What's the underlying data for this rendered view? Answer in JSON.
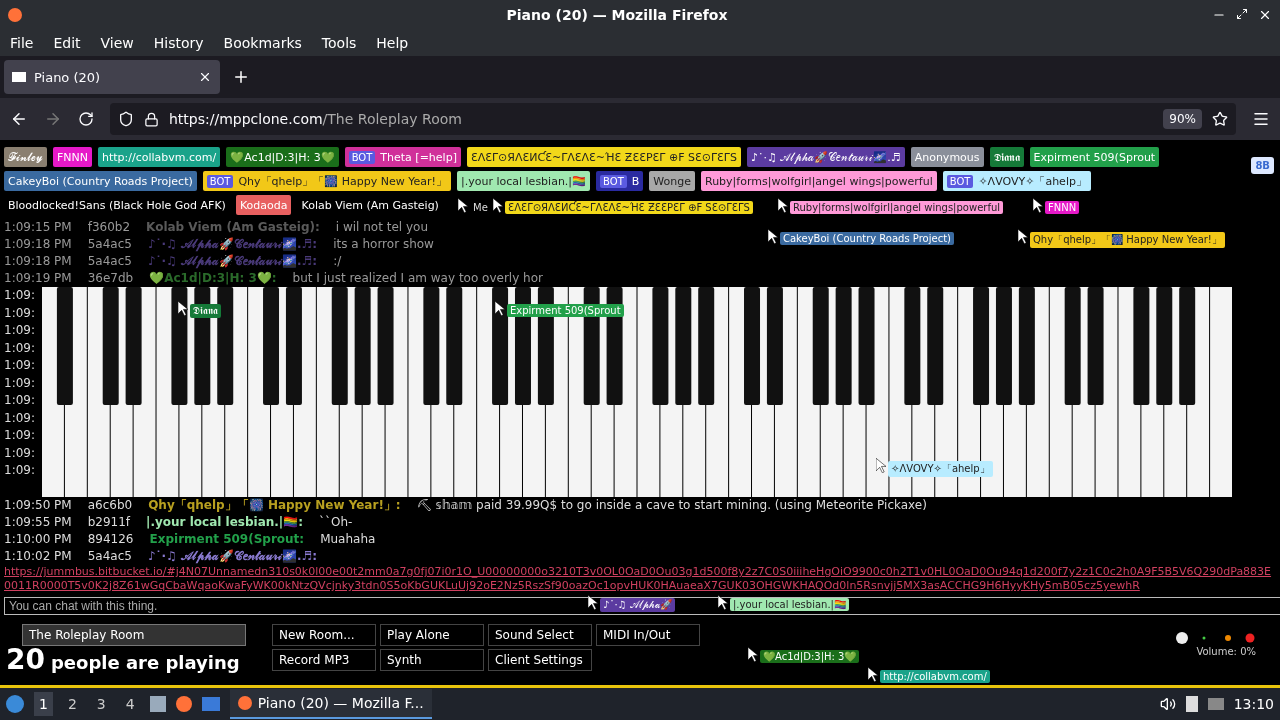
{
  "window": {
    "title": "Piano (20) — Mozilla Firefox"
  },
  "menu": [
    "File",
    "Edit",
    "View",
    "History",
    "Bookmarks",
    "Tools",
    "Help"
  ],
  "tabs": [
    {
      "label": "Piano (20)",
      "selected": true
    }
  ],
  "address": {
    "host": "https://mppclone.com",
    "path": "/The Roleplay Room",
    "zoom": "90%"
  },
  "corner_button": "8B",
  "user_rows": [
    [
      {
        "name": "𝓕𝓲𝓷𝓵𝓮𝔂",
        "color": "#8a7f70"
      },
      {
        "name": "FNNN",
        "color": "#e619c8"
      },
      {
        "name": "http://collabvm.com/",
        "color": "#1aa38a"
      },
      {
        "name": "💚Ac1d|D:3|H: 3💚",
        "color": "#1a6e1a"
      },
      {
        "name": "Theta [=help]",
        "color": "#d0309a",
        "badge": "BOT"
      },
      {
        "name": "ƐΛƐΓ⊙ЯΛƐИƇƐ~ΓΛƐΛƐ~ΉƐ ƵƐƐPƐΓ ⊕F SƐ⊙ΓƐΓS",
        "color": "#f2d81a"
      },
      {
        "name": "♪˙·♫ 𝒜𝓁𝓅𝒽𝒶🚀𝒞𝑒𝓃𝓉𝒶𝓊𝓇𝒾🌌.♬",
        "color": "#5b3ba0"
      },
      {
        "name": "Anonymous",
        "color": "#8a8f9a"
      },
      {
        "name": "𝕯𝖎𝖆𝖓𝖆",
        "color": "#157a38"
      },
      {
        "name": "Expirment 509(Sprout",
        "color": "#22a04a"
      }
    ],
    [
      {
        "name": "CakeyBoi (Country Roads Project)",
        "color": "#3a6aa0"
      },
      {
        "name": "Qhy「qhelp」「🎆 Happy New Year!」",
        "color": "#f2c818",
        "badge": "BOT"
      },
      {
        "name": "|.your local lesbian.|🏳️‍🌈",
        "color": "#a0e8b0"
      },
      {
        "name": "B",
        "color": "#2a2aa0",
        "badge": "BOT"
      },
      {
        "name": "Wonge",
        "color": "#a8a8a8"
      },
      {
        "name": "Ruby|forms|wolfgirl|angel wings|powerful",
        "color": "#ff9ad8"
      },
      {
        "name": "✧ΛVOVY✧「ahelp」",
        "color": "#b8ecff",
        "badge": "BOT"
      }
    ],
    [
      {
        "name": "Bloodlocked!Sans (Black Hole God AFK)",
        "color": "#000000"
      },
      {
        "name": "Kodaoda",
        "color": "#e86060"
      },
      {
        "name": "Kolab Viem (Am Gasteig)",
        "color": "#000000"
      }
    ]
  ],
  "chat_top": [
    {
      "time": "1:09:15 PM",
      "id": "f360b2",
      "name": "Kolab Viem (Am Gasteig):",
      "color": "#5a5a5a",
      "text": "i wil not tel you"
    },
    {
      "time": "1:09:18 PM",
      "id": "5a4ac5",
      "name": "♪˙·♫ 𝒜𝓁𝓅𝒽𝒶🚀𝒞𝑒𝓃𝓉𝒶𝓊𝓇𝒾🌌.♬:",
      "color": "#4a3a7a",
      "text": "its a horror show"
    },
    {
      "time": "1:09:18 PM",
      "id": "5a4ac5",
      "name": "♪˙·♫ 𝒜𝓁𝓅𝒽𝒶🚀𝒞𝑒𝓃𝓉𝒶𝓊𝓇𝒾🌌.♬:",
      "color": "#4a3a7a",
      "text": ":/"
    },
    {
      "time": "1:09:19 PM",
      "id": "36e7db",
      "name": "💚Ac1d|D:3|H: 3💚:",
      "color": "#2a6a2a",
      "text": "but I just realized I am way too overly hor"
    }
  ],
  "chat_behind_piano": [
    "1:09:",
    "1:09:",
    "1:09:",
    "1:09:",
    "1:09:",
    "1:09:",
    "1:09:",
    "1:09:",
    "1:09:",
    "1:09:",
    "1:09:"
  ],
  "chat_bottom": [
    {
      "time": "1:09:50 PM",
      "id": "a6c6b0",
      "name": "Qhy「qhelp」「🎆 Happy New Year!」:",
      "color": "#b8a020",
      "text": "⛏ 𝕤𝕙𝕒𝕞 paid 39.99Q$ to go inside a cave to start mining. (using Meteorite Pickaxe)"
    },
    {
      "time": "1:09:55 PM",
      "id": "b2911f",
      "name": "|.your local lesbian.|🏳️‍🌈:",
      "color": "#a0e8b0",
      "text": "``Oh-"
    },
    {
      "time": "1:10:00 PM",
      "id": "894126",
      "name": "Expirment 509(Sprout:",
      "color": "#22a04a",
      "text": "Muahaha"
    },
    {
      "time": "1:10:02 PM",
      "id": "5a4ac5",
      "name": "♪˙·♫ 𝒜𝓁𝓅𝒽𝒶🚀𝒞𝑒𝓃𝓉𝒶𝓊𝓇𝒾🌌.♬:",
      "color": "#8a7ad0",
      "link": "https://jummbus.bitbucket.io/#j4N07Unnamedn310s0k0l00e00t2mm0a7g0fj07i0r1O_U00000000o3210T3v0OL0OaD0Ou03g1d500f8y2z7C0S0iiiheHgOiO9900c0h2T1v0HL0OaD0Ou94q1d200f7y2z1C0c2h0A9F5B5V6Q290dPa883E0011R0000T5v0K2j8Z61wGqCbaWqaoKwaFyWK00kNtzQVcjnky3tdn0S5oKbGUKLuUj92oE2Nz5RszSf90oazOc1opvHUK0HAuaeaX7GUK03OHGWKHAQOd0ln5Rsnvjj5MX3asACCHG9H6HyyKHy5mB05cz5yewhR"
    }
  ],
  "chat_input": {
    "placeholder": "You can chat with this thing."
  },
  "room": "The Roleplay Room",
  "buttons": [
    "New Room...",
    "Play Alone",
    "Sound Select",
    "MIDI In/Out",
    "Record MP3",
    "Synth",
    "Client Settings"
  ],
  "players": {
    "count": "20",
    "label": "people are playing"
  },
  "volume": {
    "label": "Volume: 0%"
  },
  "cursors": [
    {
      "name": "Me"
    },
    {
      "name": "ƐΛƐΓ⊙ЯΛƐИƇƐ~ΓΛƐΛƐ~ΉƐ ƵƐƐPƐΓ ⊕F SƐ⊙ΓƐΓS",
      "color": "#f2d81a"
    },
    {
      "name": "Ruby|forms|wolfgirl|angel wings|powerful",
      "color": "#ff9ad8"
    },
    {
      "name": "FNNN",
      "color": "#e619c8"
    },
    {
      "name": "CakeyBoi (Country Roads Project)",
      "color": "#3a6aa0"
    },
    {
      "name": "Qhy「qhelp」「🎆 Happy New Year!」",
      "color": "#f2c818"
    },
    {
      "name": "𝕯𝖎𝖆𝖓𝖆",
      "color": "#157a38"
    },
    {
      "name": "Expirment 509(Sprout",
      "color": "#22a04a"
    },
    {
      "name": "✧ΛVOVY✧「ahelp」",
      "color": "#b8ecff"
    },
    {
      "name": "♪˙·♫ 𝒜𝓁𝓅𝒽𝒶🚀",
      "color": "#5b3ba0"
    },
    {
      "name": "|.your local lesbian.|🏳️‍🌈",
      "color": "#a0e8b0"
    },
    {
      "name": "💚Ac1d|D:3|H: 3💚",
      "color": "#1a6e1a"
    },
    {
      "name": "http://collabvm.com/",
      "color": "#1aa38a"
    }
  ],
  "taskbar": {
    "workspaces": [
      {
        "label": "1",
        "selected": true
      },
      {
        "label": "2",
        "selected": false
      },
      {
        "label": "3",
        "selected": false
      },
      {
        "label": "4",
        "selected": false
      }
    ],
    "task": "Piano (20) — Mozilla F...",
    "clock": "13:10"
  }
}
